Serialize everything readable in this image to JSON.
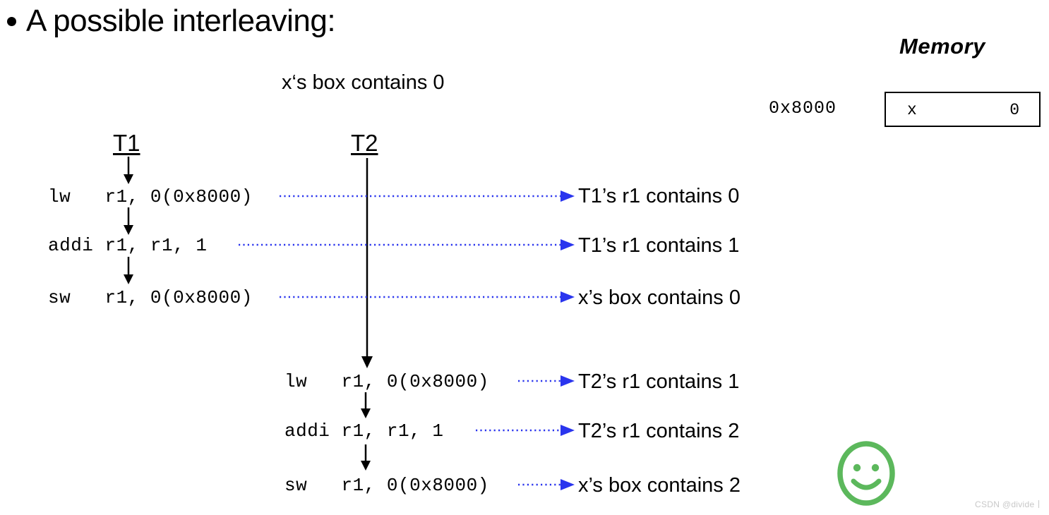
{
  "slide": {
    "title": "A possible interleaving:",
    "bullet_glyph": "bullet-dot"
  },
  "memory": {
    "heading": "Memory",
    "address": "0x8000",
    "cell": {
      "name": "x",
      "value": "0"
    }
  },
  "top_note": "x‘s box contains 0",
  "threads": [
    {
      "id": "t1",
      "label": "T1"
    },
    {
      "id": "t2",
      "label": "T2"
    }
  ],
  "t1_instructions": [
    {
      "text": "lw   r1, 0(0x8000)"
    },
    {
      "text": "addi r1, r1, 1"
    },
    {
      "text": "sw   r1, 0(0x8000)"
    }
  ],
  "t2_instructions": [
    {
      "text": "lw   r1, 0(0x8000)"
    },
    {
      "text": "addi r1, r1, 1"
    },
    {
      "text": "sw   r1, 0(0x8000)"
    }
  ],
  "annotations": [
    {
      "text": "T1’s r1 contains 0"
    },
    {
      "text": "T1’s r1 contains 1"
    },
    {
      "text": "x’s box contains 0"
    },
    {
      "text": "T2’s r1 contains 1"
    },
    {
      "text": "T2’s r1 contains 2"
    },
    {
      "text": "x’s box contains 2"
    }
  ],
  "colors": {
    "connector_blue": "#2a35ee",
    "smiley_green": "#5cb85c",
    "watermark_gray": "#c8c8c8",
    "ink_black": "#000000"
  },
  "watermark": "CSDN @divide丨"
}
